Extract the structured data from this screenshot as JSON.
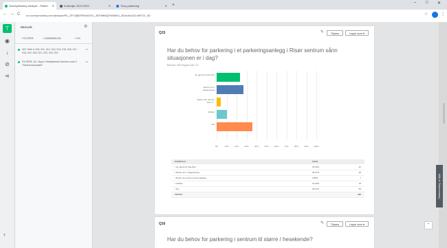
{
  "browser": {
    "tabs": [
      {
        "label": "SurveyMonkey Analyze - Parker",
        "color": "#00bf6f"
      },
      {
        "label": "Kultursjkr 2019 2020",
        "color": "#555555"
      },
      {
        "label": "Tivoy parkering",
        "color": "#1a73e8"
      }
    ],
    "new_tab": "+",
    "url": "no.surveymonkey.com/analyze/RL_ZFC9jBOFMx6OOC_3DF8tb5QFhNMbG_3Dsu4kzZZLe5FOX_3D",
    "back": "←",
    "forward": "→",
    "reload": "C",
    "window_controls": [
      "–",
      "□",
      "✕"
    ]
  },
  "rail": {
    "icons": [
      "filter-icon",
      "eye-icon",
      "download-icon",
      "link-icon",
      "share-icon"
    ]
  },
  "panel": {
    "title": "REGLER",
    "tabs": [
      "+ FILTRER",
      "+ SAMMENLIGN",
      "+ VIS"
    ],
    "filters": [
      {
        "text": "VIS: Side 4: 015, 011, 012, 013, 014, 015, 016, 017, 018, 019, 020, 021, 022, 023, 024"
      },
      {
        "text": "FILTRER: Q1: Jeg er: Rettsstrende innenfor sone 2: \"Sentrumsomradet\""
      }
    ],
    "collapse": "‹"
  },
  "question1": {
    "number": "Q15",
    "tools": {
      "tilpass": "Tilpass",
      "lagre": "Lagre som ▾"
    },
    "title": "Har du behov for parkering i et parkeringsanlegg i Risør sentrum sånn situasjonen er i dag?",
    "meta": "Besvart: 180    Hoppet over: 10",
    "table": {
      "headers": [
        "SVARVALG",
        "SVAR",
        ""
      ],
      "rows": [
        {
          "label": "Ja, gjennom hele året",
          "pct": "23,33%",
          "count": "42"
        },
        {
          "label": "Delvis, kun i helgesesong",
          "pct": "26,67%",
          "count": "48"
        },
        {
          "label": "Delvis, kun utenom ferie-helgelse",
          "pct": "3,89%",
          "count": "7"
        },
        {
          "label": "Usikker",
          "pct": "10,00%",
          "count": "18"
        },
        {
          "label": "Nei",
          "pct": "36,11%",
          "count": "65"
        }
      ],
      "total_label": "TOTALT",
      "total_count": "180"
    }
  },
  "question2": {
    "number": "Q16",
    "tools": {
      "tilpass": "Tilpass",
      "lagre": "Lagre som ▾"
    },
    "title": "Har du behov for parkering i sentrum til større / hesekende?"
  },
  "feedback": "Tilbakemelding ▲ Hjelp",
  "to_top": "⌃",
  "chart_data": {
    "type": "bar",
    "orientation": "horizontal",
    "categories": [
      "Ja, gjennom hele året",
      "Delvis, kun i helgesesong",
      "Delvis, kun utenom ferie-h...",
      "Usikker",
      "Nei"
    ],
    "values": [
      23.33,
      26.67,
      3.89,
      10.0,
      36.11
    ],
    "colors": [
      "#00bf6f",
      "#507cb6",
      "#f9be00",
      "#6bc8cd",
      "#ff8b4f"
    ],
    "xticks": [
      "0%",
      "10%",
      "20%",
      "30%",
      "40%",
      "50%",
      "60%",
      "70%",
      "80%",
      "90%",
      "100%"
    ],
    "xlim": [
      0,
      100
    ],
    "grid": true
  }
}
